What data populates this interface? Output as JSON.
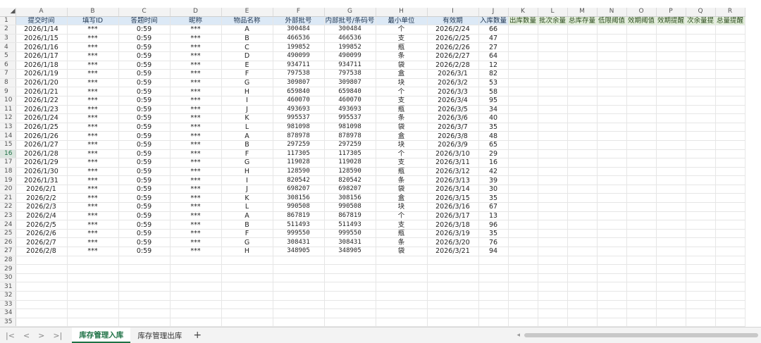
{
  "column_letters": [
    "A",
    "B",
    "C",
    "D",
    "E",
    "F",
    "G",
    "H",
    "I",
    "J",
    "K",
    "L",
    "M",
    "N",
    "O",
    "P",
    "Q",
    "R"
  ],
  "headers": [
    "提交时间",
    "填写ID",
    "答题时间",
    "昵称",
    "物品名称",
    "外部批号",
    "内部批号/条码号",
    "最小单位",
    "有效期",
    "入库数量",
    "出库数量",
    "批次余量",
    "总库存量",
    "低限阈值",
    "效期阈值",
    "效期提醒",
    "次余量提",
    "总量提醒"
  ],
  "header_colors": {
    "blue": "#dce9f6",
    "green": "#e2efda"
  },
  "rows": [
    [
      "2026/1/14",
      "***",
      "0:59",
      "***",
      "A",
      "300484",
      "300484",
      "个",
      "2026/2/24",
      "66"
    ],
    [
      "2026/1/15",
      "***",
      "0:59",
      "***",
      "B",
      "466536",
      "466536",
      "支",
      "2026/2/25",
      "47"
    ],
    [
      "2026/1/16",
      "***",
      "0:59",
      "***",
      "C",
      "199852",
      "199852",
      "瓶",
      "2026/2/26",
      "27"
    ],
    [
      "2026/1/17",
      "***",
      "0:59",
      "***",
      "D",
      "490099",
      "490099",
      "条",
      "2026/2/27",
      "64"
    ],
    [
      "2026/1/18",
      "***",
      "0:59",
      "***",
      "E",
      "934711",
      "934711",
      "袋",
      "2026/2/28",
      "12"
    ],
    [
      "2026/1/19",
      "***",
      "0:59",
      "***",
      "F",
      "797538",
      "797538",
      "盒",
      "2026/3/1",
      "82"
    ],
    [
      "2026/1/20",
      "***",
      "0:59",
      "***",
      "G",
      "309807",
      "309807",
      "块",
      "2026/3/2",
      "53"
    ],
    [
      "2026/1/21",
      "***",
      "0:59",
      "***",
      "H",
      "659840",
      "659840",
      "个",
      "2026/3/3",
      "58"
    ],
    [
      "2026/1/22",
      "***",
      "0:59",
      "***",
      "I",
      "460070",
      "460070",
      "支",
      "2026/3/4",
      "95"
    ],
    [
      "2026/1/23",
      "***",
      "0:59",
      "***",
      "J",
      "493693",
      "493693",
      "瓶",
      "2026/3/5",
      "34"
    ],
    [
      "2026/1/24",
      "***",
      "0:59",
      "***",
      "K",
      "995537",
      "995537",
      "条",
      "2026/3/6",
      "40"
    ],
    [
      "2026/1/25",
      "***",
      "0:59",
      "***",
      "L",
      "981098",
      "981098",
      "袋",
      "2026/3/7",
      "35"
    ],
    [
      "2026/1/26",
      "***",
      "0:59",
      "***",
      "A",
      "878978",
      "878978",
      "盒",
      "2026/3/8",
      "48"
    ],
    [
      "2026/1/27",
      "***",
      "0:59",
      "***",
      "B",
      "297259",
      "297259",
      "块",
      "2026/3/9",
      "65"
    ],
    [
      "2026/1/28",
      "***",
      "0:59",
      "***",
      "F",
      "117305",
      "117305",
      "个",
      "2026/3/10",
      "29"
    ],
    [
      "2026/1/29",
      "***",
      "0:59",
      "***",
      "G",
      "119028",
      "119028",
      "支",
      "2026/3/11",
      "16"
    ],
    [
      "2026/1/30",
      "***",
      "0:59",
      "***",
      "H",
      "128590",
      "128590",
      "瓶",
      "2026/3/12",
      "42"
    ],
    [
      "2026/1/31",
      "***",
      "0:59",
      "***",
      "I",
      "820542",
      "820542",
      "条",
      "2026/3/13",
      "39"
    ],
    [
      "2026/2/1",
      "***",
      "0:59",
      "***",
      "J",
      "698207",
      "698207",
      "袋",
      "2026/3/14",
      "30"
    ],
    [
      "2026/2/2",
      "***",
      "0:59",
      "***",
      "K",
      "308156",
      "308156",
      "盒",
      "2026/3/15",
      "35"
    ],
    [
      "2026/2/3",
      "***",
      "0:59",
      "***",
      "L",
      "990508",
      "990508",
      "块",
      "2026/3/16",
      "67"
    ],
    [
      "2026/2/4",
      "***",
      "0:59",
      "***",
      "A",
      "867819",
      "867819",
      "个",
      "2026/3/17",
      "13"
    ],
    [
      "2026/2/5",
      "***",
      "0:59",
      "***",
      "B",
      "511493",
      "511493",
      "支",
      "2026/3/18",
      "96"
    ],
    [
      "2026/2/6",
      "***",
      "0:59",
      "***",
      "F",
      "999550",
      "999550",
      "瓶",
      "2026/3/19",
      "35"
    ],
    [
      "2026/2/7",
      "***",
      "0:59",
      "***",
      "G",
      "308431",
      "308431",
      "条",
      "2026/3/20",
      "76"
    ],
    [
      "2026/2/8",
      "***",
      "0:59",
      "***",
      "H",
      "348905",
      "348905",
      "袋",
      "2026/3/21",
      "94"
    ]
  ],
  "total_rows": 35,
  "selected_row": 16,
  "sheet_tabs": {
    "active": "库存管理入库",
    "other": "库存管理出库",
    "add": "+"
  },
  "nav_icons": {
    "first": "|<",
    "prev": "<",
    "next": ">",
    "last": ">|"
  },
  "accent_color": "#1e7145"
}
